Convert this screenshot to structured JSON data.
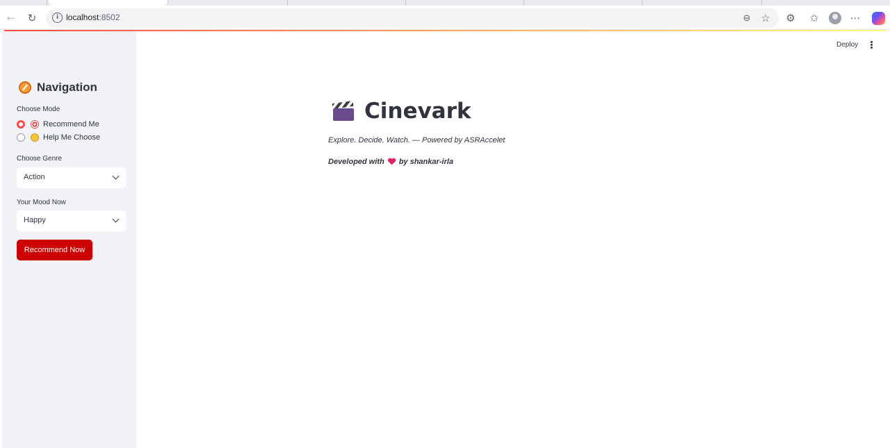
{
  "browser": {
    "url_host": "localhost",
    "url_port": ":8502"
  },
  "sidebar": {
    "title": "Navigation",
    "mode_label": "Choose Mode",
    "mode_options": [
      {
        "label": "Recommend Me",
        "selected": true
      },
      {
        "label": "Help Me Choose",
        "selected": false
      }
    ],
    "genre_label": "Choose Genre",
    "genre_value": "Action",
    "mood_label": "Your Mood Now",
    "mood_value": "Happy",
    "button_label": "Recommend Now",
    "button_color": "#cc0000",
    "accent_color": "#ff4b4b"
  },
  "header": {
    "deploy_label": "Deploy"
  },
  "main": {
    "title": "Cinevark",
    "tagline": "Explore. Decide. Watch. — Powered by ASRAccelet",
    "dev_prefix": "Developed with",
    "dev_suffix": "by shankar-irla"
  }
}
